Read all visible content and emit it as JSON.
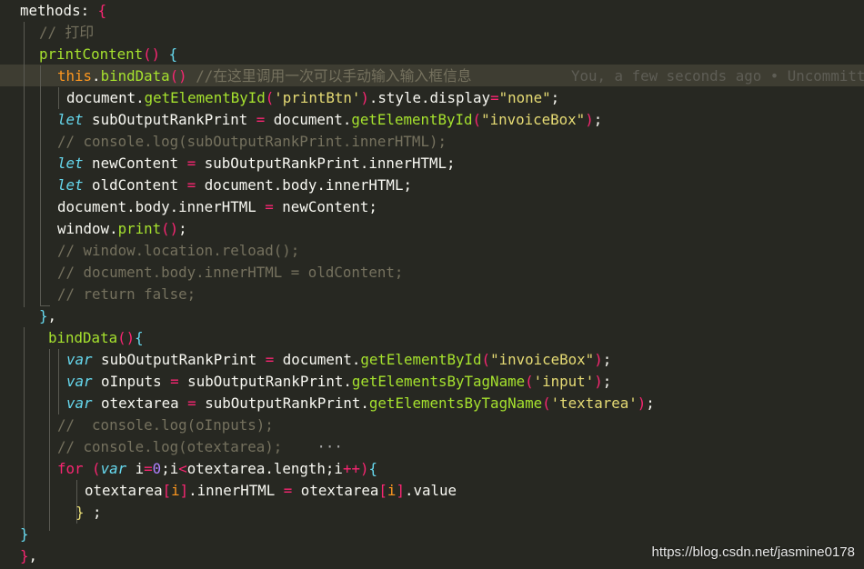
{
  "code": {
    "l1_methods": "methods: ",
    "l1_brace": "{",
    "l2_comment": "// 打印",
    "l3_fn": "printContent",
    "l3_parens": "()",
    "l3_brace": " {",
    "l4_this": "this",
    "l4_dot": ".",
    "l4_fn": "bindData",
    "l4_parens": "()",
    "l4_comment": " //在这里调用一次可以手动输入输入框信息",
    "l4_blame": "You, a few seconds ago • Uncommitted changes",
    "l5_obj": "document.",
    "l5_fn": "getElementById",
    "l5_open": "(",
    "l5_str": "'printBtn'",
    "l5_close": ")",
    "l5_rest": ".style.display",
    "l5_eq": "=",
    "l5_str2": "\"none\"",
    "l5_semi": ";",
    "l6_kw": "let",
    "l6_var": " subOutputRankPrint ",
    "l6_eq": "=",
    "l6_obj": " document.",
    "l6_fn": "getElementById",
    "l6_open": "(",
    "l6_str": "\"invoiceBox\"",
    "l6_close": ")",
    "l6_semi": ";",
    "l7_comment": "// console.log(subOutputRankPrint.innerHTML);",
    "l8_kw": "let",
    "l8_var": " newContent ",
    "l8_eq": "=",
    "l8_rest": " subOutputRankPrint.innerHTML;",
    "l9_kw": "let",
    "l9_var": " oldContent ",
    "l9_eq": "=",
    "l9_rest": " document.body.innerHTML;",
    "l10_lhs": "document.body.innerHTML ",
    "l10_eq": "=",
    "l10_rest": " newContent;",
    "l11_obj": "window.",
    "l11_fn": "print",
    "l11_parens": "()",
    "l11_semi": ";",
    "l12_comment": "// window.location.reload();",
    "l13_comment": "// document.body.innerHTML = oldContent;",
    "l14_comment": "// return false;",
    "l15_close": "}",
    "l15_comma": ",",
    "l16_fn": "bindData",
    "l16_parens": "()",
    "l16_brace": "{",
    "l17_kw": "var",
    "l17_var": " subOutputRankPrint ",
    "l17_eq": "=",
    "l17_obj": " document.",
    "l17_fn": "getElementById",
    "l17_open": "(",
    "l17_str": "\"invoiceBox\"",
    "l17_close": ")",
    "l17_semi": ";",
    "l18_kw": "var",
    "l18_var": " oInputs ",
    "l18_eq": "=",
    "l18_obj": " subOutputRankPrint.",
    "l18_fn": "getElementsByTagName",
    "l18_open": "(",
    "l18_str": "'input'",
    "l18_close": ")",
    "l18_semi": ";",
    "l19_kw": "var",
    "l19_var": " otextarea ",
    "l19_eq": "=",
    "l19_obj": " subOutputRankPrint.",
    "l19_fn": "getElementsByTagName",
    "l19_open": "(",
    "l19_str": "'textarea'",
    "l19_close": ")",
    "l19_semi": ";",
    "l20_comment": "//  console.log(oInputs);",
    "l21_comment": "// console.log(otextarea);",
    "l21_fold": "    ···",
    "l22_kw": "for",
    "l22_p1": " (",
    "l22_kw2": "var",
    "l22_i": " i",
    "l22_eq": "=",
    "l22_num": "0",
    "l22_mid": ";i",
    "l22_lt": "<",
    "l22_len": "otextarea.length;i",
    "l22_inc": "++",
    "l22_p2": ")",
    "l22_brace": "{",
    "l23_a": "otextarea",
    "l23_b1": "[",
    "l23_i": "i",
    "l23_b2": "]",
    "l23_prop": ".innerHTML ",
    "l23_eq": "=",
    "l23_c": " otextarea",
    "l23_b3": "[",
    "l23_i2": "i",
    "l23_b4": "]",
    "l23_rest": ".value",
    "l24_close": "}",
    "l24_semi": " ;",
    "l25_close": "}",
    "l26_close": "}",
    "l26_comma": ","
  },
  "watermark": "https://blog.csdn.net/jasmine0178",
  "colors": {
    "background": "#272822",
    "keyword": "#66d9ef",
    "function": "#a6e22e",
    "string": "#e6db74",
    "operator": "#f92672",
    "comment": "#75715e",
    "number": "#ae81ff",
    "this": "#fd971f"
  }
}
